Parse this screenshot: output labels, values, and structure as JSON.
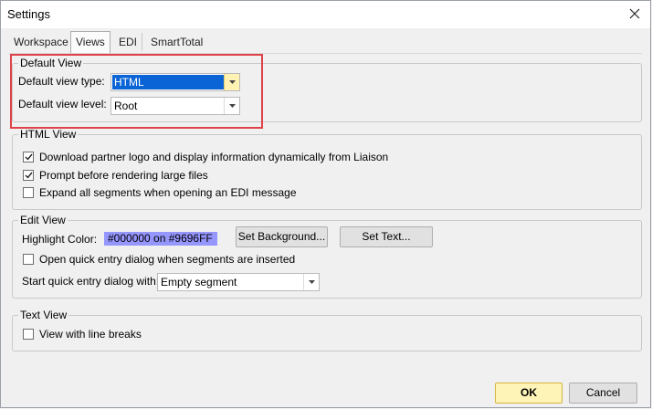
{
  "window": {
    "title": "Settings"
  },
  "icons": {
    "close": "close-icon",
    "check": "checkmark-icon",
    "dropdown": "chevron-down-icon"
  },
  "tabs": [
    {
      "label": "Workspace",
      "active": false
    },
    {
      "label": "Views",
      "active": true
    },
    {
      "label": "EDI",
      "active": false
    },
    {
      "label": "SmartTotal",
      "active": false
    }
  ],
  "default_view": {
    "legend": "Default View",
    "type_label": "Default view type:",
    "type_value": "HTML",
    "level_label": "Default view level:",
    "level_value": "Root"
  },
  "html_view": {
    "legend": "HTML View",
    "options": [
      {
        "label": "Download partner logo and display information dynamically from Liaison",
        "checked": true
      },
      {
        "label": "Prompt before rendering large files",
        "checked": true
      },
      {
        "label": "Expand all segments when opening an EDI message",
        "checked": false
      }
    ]
  },
  "edit_view": {
    "legend": "Edit View",
    "highlight_label": "Highlight Color:",
    "highlight_value": "#000000 on #9696FF",
    "highlight_bg": "#9696FF",
    "highlight_fg": "#000000",
    "set_background_label": "Set Background...",
    "set_text_label": "Set Text...",
    "quick_entry_option": {
      "label": "Open quick entry dialog when segments are inserted",
      "checked": false
    },
    "start_with_label": "Start quick entry dialog with:",
    "start_with_value": "Empty segment"
  },
  "text_view": {
    "legend": "Text View",
    "option": {
      "label": "View with line breaks",
      "checked": false
    }
  },
  "footer": {
    "ok_label": "OK",
    "cancel_label": "Cancel"
  },
  "colors": {
    "annotation_border": "#e0424a",
    "ok_button": "#fff4b8",
    "selection": "#0a64d6"
  }
}
